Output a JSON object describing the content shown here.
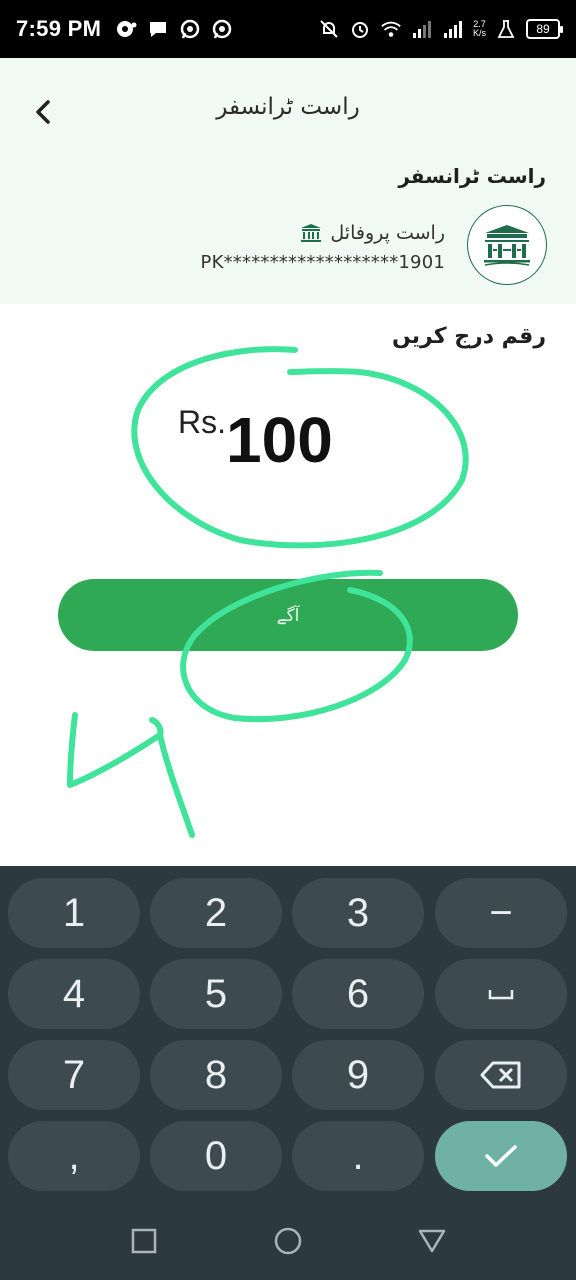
{
  "status_bar": {
    "time": "7:59 PM",
    "net_speed_value": "2.7",
    "net_speed_unit": "K/s",
    "battery": "89",
    "left_icons": [
      "notification-icon",
      "chat-bubble-icon",
      "whatsapp-icon",
      "whatsapp-icon"
    ],
    "right_icons": [
      "mute-icon",
      "alarm-icon",
      "wifi-icon",
      "signal-icon",
      "signal-icon"
    ]
  },
  "header": {
    "title": "راست ٹرانسفر",
    "back_icon": "chevron-left-icon"
  },
  "transfer": {
    "section_title": "راست ٹرانسفر",
    "profile_name": "راست پروفائل",
    "account_number": "PK*******************1901"
  },
  "amount": {
    "label": "رقم درج کریں",
    "currency": "Rs.",
    "value": "100"
  },
  "actions": {
    "next_label": "آگے"
  },
  "keyboard": {
    "keys": [
      "1",
      "2",
      "3",
      "−",
      "4",
      "5",
      "6",
      "␣",
      "7",
      "8",
      "9",
      "backspace-icon",
      ",",
      "0",
      ".",
      "check-icon"
    ]
  },
  "nav": {
    "icons": [
      "recent-apps-icon",
      "home-icon",
      "back-triangle-icon"
    ]
  },
  "colors": {
    "accent_green": "#2fa956",
    "annotation_green": "#3fe39a",
    "keyboard_bg": "#2c3a40",
    "key_bg": "#3d4b51",
    "action_key": "#70b1a6"
  }
}
